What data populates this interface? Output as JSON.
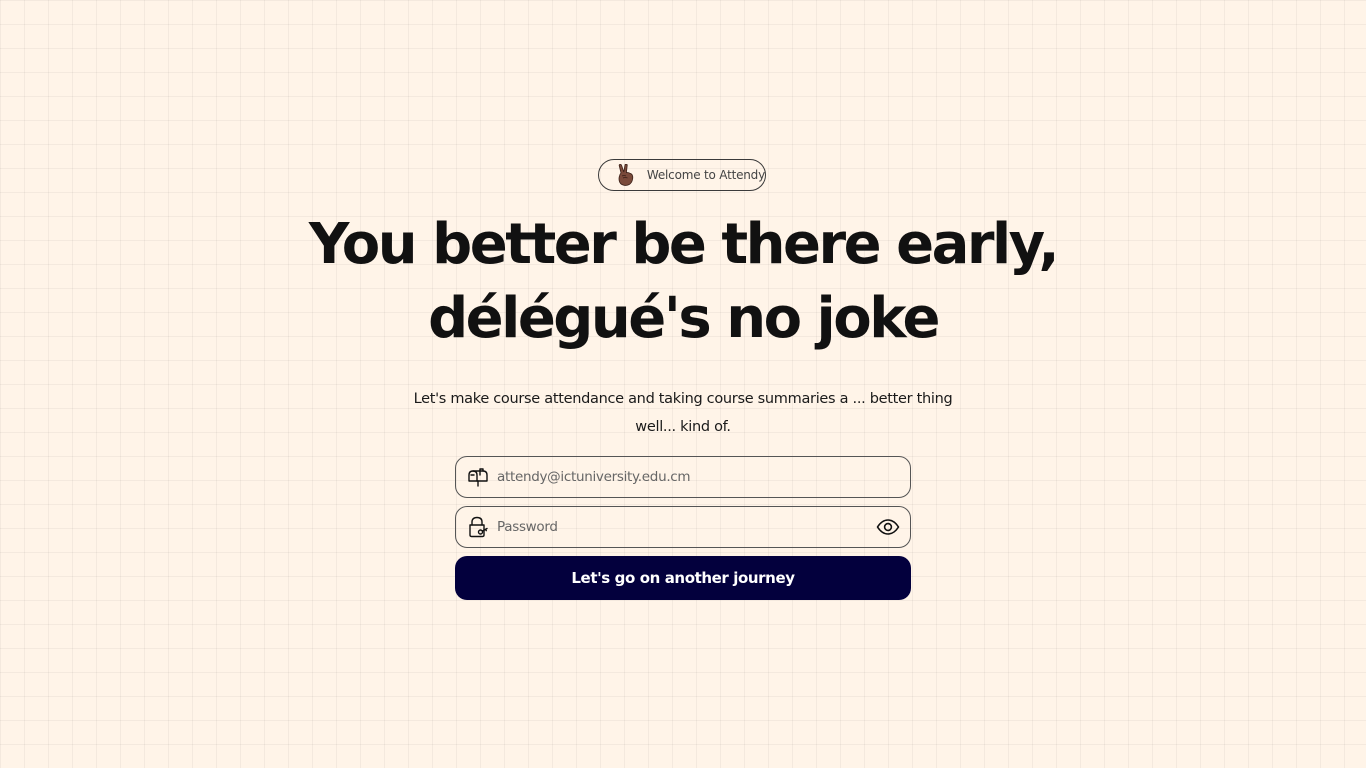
{
  "badge": {
    "icon": "victory-hand-icon",
    "text": "Welcome to Attendy"
  },
  "headline": {
    "line1": "You better be there early,",
    "line2": "délégué's no joke"
  },
  "subtitle": {
    "line1": "Let's make course attendance and taking course summaries a ... better thing",
    "line2": "well... kind of."
  },
  "form": {
    "email": {
      "icon": "mailbox-icon",
      "placeholder": "attendy@ictuniversity.edu.cm",
      "value": ""
    },
    "password": {
      "icon": "lock-icon",
      "placeholder": "Password",
      "value": "",
      "toggle_icon": "eye-icon"
    },
    "submit_label": "Let's go on another journey"
  },
  "colors": {
    "background": "#fff4e8",
    "button": "#03003d",
    "button_text": "#ffffff",
    "border": "#555555"
  }
}
